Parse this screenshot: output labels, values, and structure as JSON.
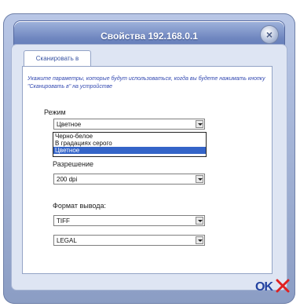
{
  "window": {
    "title": "Свойства 192.168.0.1",
    "close_glyph": "×",
    "tab_label": "Сканировать в"
  },
  "instruction": "Укажите параметры, которые будут использоваться, когда вы будете нажимать кнопку \"Сканировать в\" на устройстве",
  "mode": {
    "label": "Режим",
    "selected": "Цветное",
    "options": [
      "Черно-белое",
      "В градациях серого",
      "Цветное"
    ],
    "highlighted_index": 2
  },
  "resolution": {
    "label": "Разрешение",
    "selected": "200 dpi"
  },
  "output": {
    "label": "Формат вывода:",
    "format_selected": "TIFF",
    "paper_selected": "LEGAL"
  },
  "buttons": {
    "ok": "OK",
    "cancel_icon": "red-x-icon"
  },
  "colors": {
    "title_bar": "#6f86bf",
    "instruction_text": "#3248b0",
    "highlight": "#3464c8",
    "cancel": "#e02020"
  }
}
